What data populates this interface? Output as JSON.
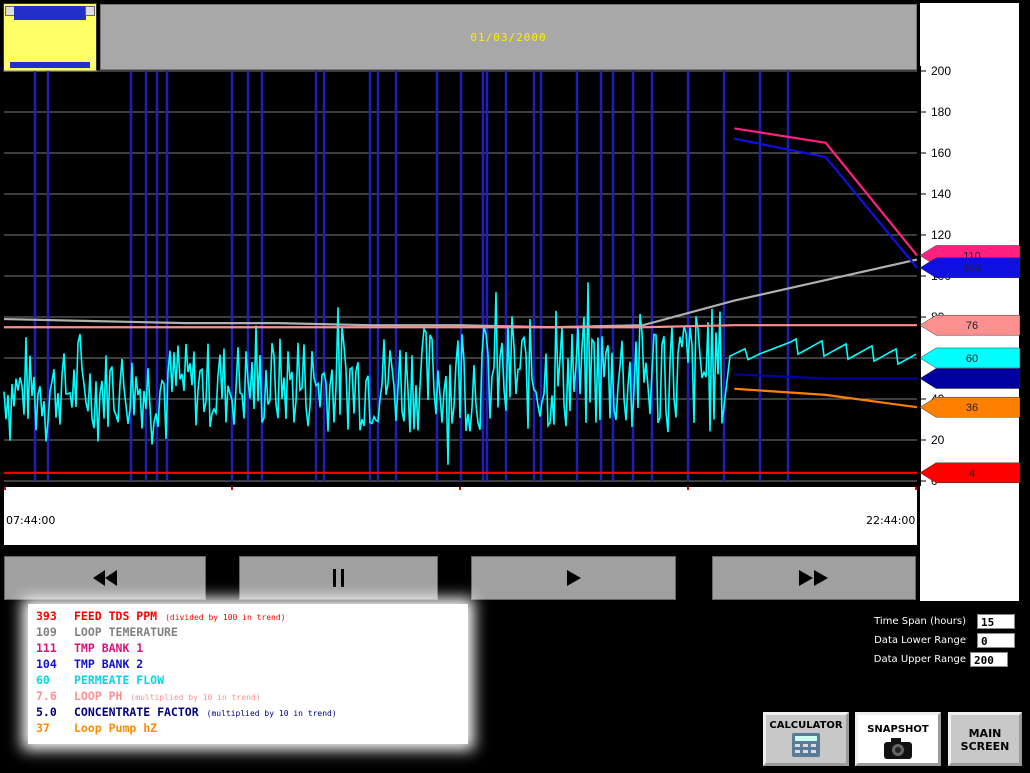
{
  "header": {
    "date": "01/03/2000"
  },
  "chart_data": {
    "type": "line",
    "y_ticks": [
      0,
      20,
      40,
      60,
      80,
      100,
      120,
      140,
      160,
      180,
      200
    ],
    "ylim": [
      0,
      200
    ],
    "x_start_label": "07:44:00",
    "x_end_label": "22:44:00",
    "grid": true,
    "series": [
      {
        "name": "FEED TDS PPM",
        "color": "#ff0000",
        "values": [
          4,
          4,
          4,
          4,
          4,
          4,
          4,
          4,
          4,
          4,
          4
        ]
      },
      {
        "name": "LOOP TEMERATURE",
        "color": "#b0b0b0",
        "values": [
          79,
          78,
          77,
          77,
          76,
          76,
          75,
          76,
          88,
          98,
          108
        ]
      },
      {
        "name": "TMP BANK 1",
        "color": "#ff2080",
        "values": [
          null,
          null,
          null,
          null,
          null,
          null,
          null,
          null,
          172,
          165,
          110
        ]
      },
      {
        "name": "TMP BANK 2",
        "color": "#1010e0",
        "values": [
          null,
          null,
          null,
          null,
          null,
          null,
          null,
          null,
          167,
          158,
          104
        ]
      },
      {
        "name": "PERMEATE FLOW",
        "color": "#00ffff",
        "values": [
          40,
          45,
          38,
          48,
          42,
          50,
          46,
          52,
          65,
          68,
          60
        ]
      },
      {
        "name": "LOOP PH",
        "color": "#ff9090",
        "values": [
          75,
          75,
          75,
          75,
          75,
          75,
          75,
          75,
          76,
          76,
          76
        ]
      },
      {
        "name": "CONCENTRATE FACTOR",
        "color": "#0000a0",
        "values": [
          null,
          null,
          null,
          null,
          null,
          null,
          null,
          null,
          52,
          50,
          50
        ]
      },
      {
        "name": "Loop Pump hZ",
        "color": "#ff8000",
        "values": [
          null,
          null,
          null,
          null,
          null,
          null,
          null,
          null,
          45,
          42,
          36
        ]
      }
    ]
  },
  "markers": [
    {
      "label": "110",
      "color": "#ff2080"
    },
    {
      "label": "104",
      "color": "#1010e0"
    },
    {
      "label": "76",
      "color": "#ff9090"
    },
    {
      "label": "60",
      "color": "#00ffff"
    },
    {
      "label": "",
      "color": "#0000a0"
    },
    {
      "label": "36",
      "color": "#ff8000"
    },
    {
      "label": "4",
      "color": "#ff0000"
    }
  ],
  "legend": [
    {
      "value": "393",
      "label": "FEED TDS PPM",
      "note": "(divided by 100 in trend)",
      "color": "#ff0000"
    },
    {
      "value": "109",
      "label": "LOOP TEMERATURE",
      "note": "",
      "color": "#808080"
    },
    {
      "value": "111",
      "label": "TMP BANK 1",
      "note": "",
      "color": "#e0107a"
    },
    {
      "value": "104",
      "label": "TMP BANK 2",
      "note": "",
      "color": "#1010d0"
    },
    {
      "value": "60",
      "label": "PERMEATE FLOW",
      "note": "",
      "color": "#00d8e8"
    },
    {
      "value": "7.6",
      "label": "LOOP PH",
      "note": "(multiplied by 10 in trend)",
      "color": "#ff9090"
    },
    {
      "value": "5.0",
      "label": "CONCENTRATE FACTOR",
      "note": "(multiplied by 10 in trend)",
      "color": "#000080"
    },
    {
      "value": "37",
      "label": "Loop Pump hZ",
      "note": "",
      "color": "#ff8c00"
    }
  ],
  "settings": {
    "time_span_label": "Time Span (hours)",
    "time_span_value": "15",
    "lower_label": "Data Lower Range",
    "lower_value": "0",
    "upper_label": "Data Upper Range",
    "upper_value": "200"
  },
  "buttons": {
    "calculator": "CALCULATOR",
    "snapshot": "SNAPSHOT",
    "main_screen_1": "MAIN",
    "main_screen_2": "SCREEN"
  },
  "icons": [
    "rewind-icon",
    "pause-icon",
    "play-icon",
    "fast-forward-icon",
    "calculator-icon",
    "camera-icon"
  ]
}
